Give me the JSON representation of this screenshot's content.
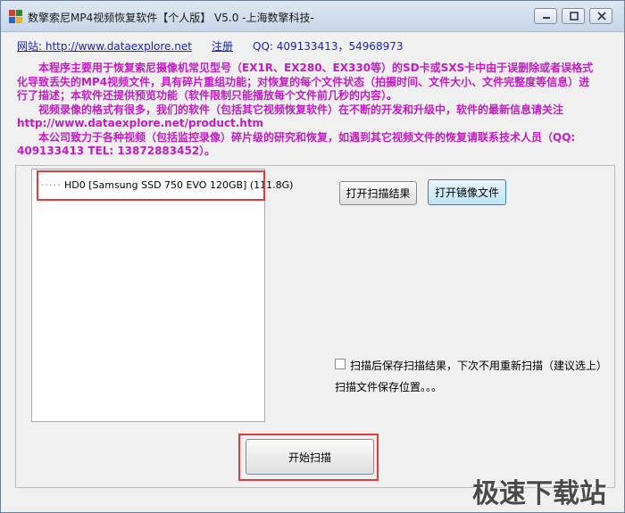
{
  "window": {
    "title": "数擎索尼MP4视频恢复软件【个人版】 V5.0  -上海数擎科技-"
  },
  "header": {
    "website_label": "网站: http://www.dataexplore.net",
    "register_label": "注册",
    "qq_label": "QQ: 409133413，54968973"
  },
  "description": {
    "para1": "　　本程序主要用于恢复索尼摄像机常见型号（EX1R、EX280、EX330等）的SD卡或SXS卡中由于误删除或者误格式化导致丢失的MP4视频文件，具有碎片重组功能；对恢复的每个文件状态（拍摄时间、文件大小、文件完整度等信息）进行了描述；本软件还提供预览功能（软件限制只能播放每个文件前几秒的内容）。",
    "para2": "　　视频录像的格式有很多，我们的软件（包括其它视频恢复软件）在不断的开发和升级中，软件的最新信息请关注 http://www.dataexplore.net/product.htm",
    "para3": "　　本公司致力于各种视频（包括监控录像）碎片级的研究和恢复，如遇到其它视频文件的恢复请联系技术人员（QQ: 409133413  TEL: 13872883452）。"
  },
  "drives": [
    {
      "text": "HD0    [Samsung SSD 750 EVO 120GB]  (111.8G)"
    }
  ],
  "buttons": {
    "open_scan_result": "打开扫描结果",
    "open_image_file": "打开镜像文件",
    "start_scan": "开始扫描"
  },
  "options": {
    "save_result_label": "扫描后保存扫描结果，下次不用重新扫描（建议选上）",
    "save_result_checked": false,
    "save_path_label": "扫描文件保存位置。。。"
  },
  "watermark": "极速下载站"
}
